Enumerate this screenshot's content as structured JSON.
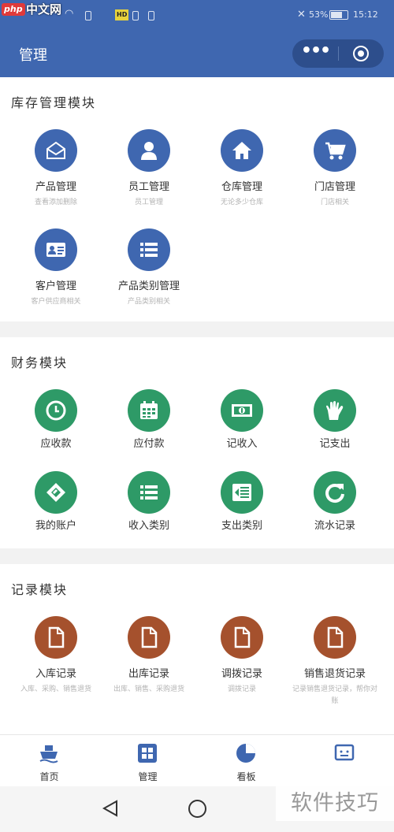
{
  "statusbar": {
    "watermark_logo": "php",
    "watermark_site": "中文网",
    "hw_badge": "HD",
    "battery": "53%",
    "time": "15:12"
  },
  "header": {
    "title": "管理",
    "more_icon": "more-dots-icon",
    "close_icon": "target-close-icon"
  },
  "inventory": {
    "title": "库存管理模块",
    "items": [
      {
        "label": "产品管理",
        "sub": "查看添加删除",
        "icon": "envelope-icon",
        "color": "#3f67b0"
      },
      {
        "label": "员工管理",
        "sub": "员工管理",
        "icon": "user-icon",
        "color": "#3f67b0"
      },
      {
        "label": "仓库管理",
        "sub": "无论多少仓库",
        "icon": "home-icon",
        "color": "#3f67b0"
      },
      {
        "label": "门店管理",
        "sub": "门店相关",
        "icon": "cart-icon",
        "color": "#3f67b0"
      },
      {
        "label": "客户管理",
        "sub": "客户供应商相关",
        "icon": "id-card-icon",
        "color": "#3f67b0"
      },
      {
        "label": "产品类别管理",
        "sub": "产品类别相关",
        "icon": "list-icon",
        "color": "#3f67b0"
      }
    ]
  },
  "finance": {
    "title": "财务模块",
    "items": [
      {
        "label": "应收款",
        "icon": "clock-icon",
        "color": "#2e9a67"
      },
      {
        "label": "应付款",
        "icon": "calendar-icon",
        "color": "#2e9a67"
      },
      {
        "label": "记收入",
        "icon": "money-icon",
        "color": "#2e9a67"
      },
      {
        "label": "记支出",
        "icon": "hand-icon",
        "color": "#2e9a67"
      },
      {
        "label": "我的账户",
        "icon": "account-icon",
        "color": "#2e9a67"
      },
      {
        "label": "收入类别",
        "icon": "list-icon",
        "color": "#2e9a67"
      },
      {
        "label": "支出类别",
        "icon": "outdent-list-icon",
        "color": "#2e9a67"
      },
      {
        "label": "流水记录",
        "icon": "refresh-icon",
        "color": "#2e9a67"
      }
    ]
  },
  "records": {
    "title": "记录模块",
    "items": [
      {
        "label": "入库记录",
        "sub": "入库、采购、销售退货",
        "icon": "file-icon",
        "color": "#a5512d"
      },
      {
        "label": "出库记录",
        "sub": "出库、销售、采购退货",
        "icon": "file-icon",
        "color": "#a5512d"
      },
      {
        "label": "调拨记录",
        "sub": "调拨记录",
        "icon": "file-icon",
        "color": "#a5512d"
      },
      {
        "label": "销售退货记录",
        "sub": "记录销售退货记录，帮你对账",
        "icon": "file-icon",
        "color": "#a5512d"
      }
    ]
  },
  "tabbar": [
    {
      "label": "首页",
      "icon": "ship-icon"
    },
    {
      "label": "管理",
      "icon": "grid-icon"
    },
    {
      "label": "看板",
      "icon": "pie-chart-icon"
    },
    {
      "label": "",
      "icon": "tv-icon"
    }
  ],
  "watermark": "软件技巧"
}
